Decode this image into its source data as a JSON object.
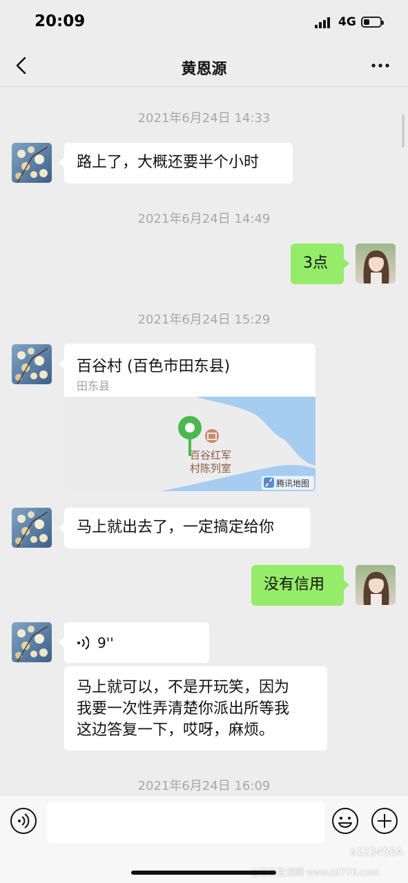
{
  "status_bar": {
    "time": "20:09",
    "network": "4G"
  },
  "header": {
    "title": "黄恩源"
  },
  "messages": {
    "ts1": "2021年6月24日 14:33",
    "m1": "路上了，大概还要半个小时",
    "ts2": "2021年6月24日 14:49",
    "m2": "3点",
    "ts3": "2021年6月24日 15:29",
    "location": {
      "title": "百谷村 (百色市田东县)",
      "subtitle": "田东县",
      "map_label_line1": "百谷红军",
      "map_label_line2": "村陈列室",
      "map_brand": "腾讯地图"
    },
    "m3": "马上就出去了，一定搞定给你",
    "m4": "没有信用",
    "voice_duration": "9''",
    "m5_line1": "马上就可以，不是开玩笑，因为",
    "m5_line2": "我要一次性弄清楚你派出所等我",
    "m5_line3": "这边答复一下，哎呀，麻烦。",
    "ts4": "2021年6月24日 16:09"
  },
  "input": {
    "value": "",
    "placeholder": ""
  },
  "watermark": {
    "line1": "a123456A",
    "line2": "@田东生活网 www.td776.com"
  },
  "colors": {
    "background": "#ededed",
    "outgoing_bubble": "#95ec69",
    "incoming_bubble": "#ffffff",
    "pin": "#4cb84f",
    "water": "#a6cdf0"
  }
}
